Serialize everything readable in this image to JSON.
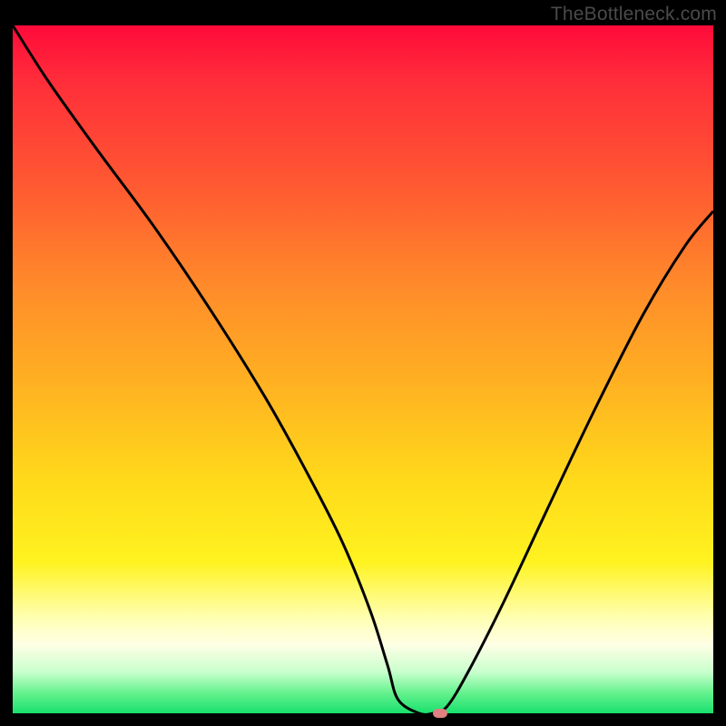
{
  "watermark": "TheBottleneck.com",
  "chart_data": {
    "type": "line",
    "title": "",
    "xlabel": "",
    "ylabel": "",
    "xlim": [
      0,
      100
    ],
    "ylim": [
      0,
      100
    ],
    "x": [
      0,
      5,
      12,
      20,
      28,
      36,
      42,
      47,
      51,
      53.5,
      55,
      58,
      60,
      62,
      65,
      70,
      76,
      83,
      90,
      96,
      100
    ],
    "values": [
      100,
      92,
      82,
      71,
      59,
      46,
      35,
      25,
      15,
      7,
      2,
      0,
      0,
      1,
      6,
      16,
      29,
      44,
      58,
      68,
      73
    ],
    "marker": {
      "x": 61,
      "y": 0
    },
    "background_gradient": {
      "stops": [
        {
          "pos": 0,
          "color": "#ff0a3a"
        },
        {
          "pos": 8,
          "color": "#ff2d3a"
        },
        {
          "pos": 22,
          "color": "#ff5532"
        },
        {
          "pos": 38,
          "color": "#ff8b2a"
        },
        {
          "pos": 52,
          "color": "#ffb122"
        },
        {
          "pos": 66,
          "color": "#ffd91a"
        },
        {
          "pos": 78,
          "color": "#fff320"
        },
        {
          "pos": 86,
          "color": "#ffffb0"
        },
        {
          "pos": 90,
          "color": "#ffffe6"
        },
        {
          "pos": 94,
          "color": "#c9ffcd"
        },
        {
          "pos": 97,
          "color": "#66f28e"
        },
        {
          "pos": 100,
          "color": "#18e06e"
        }
      ]
    }
  }
}
